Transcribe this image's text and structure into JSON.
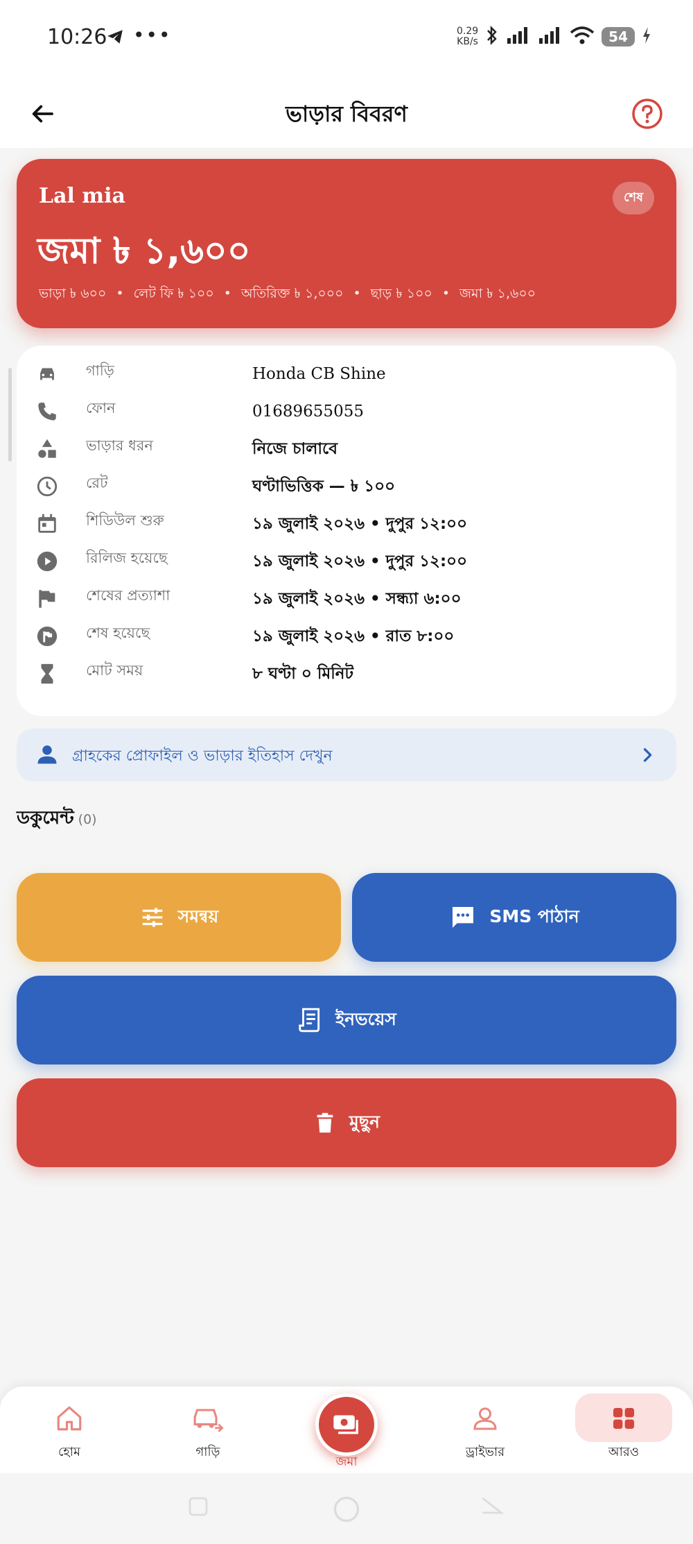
{
  "status_bar": {
    "time": "10:26",
    "speed_value": "0.29",
    "speed_unit": "KB/s",
    "battery": "54",
    "icons": [
      "telegram-icon",
      "bluetooth-icon",
      "signal-icon",
      "wifi-icon",
      "battery-icon"
    ]
  },
  "app_bar": {
    "title": "ভাড়ার বিবরণ"
  },
  "summary": {
    "customer_name": "Lal mia",
    "status_badge": "শেষ",
    "total": "জমা ৳ ১,৬০০",
    "breakdown": [
      "ভাড়া ৳ ৬০০",
      "লেট ফি ৳ ১০০",
      "অতিরিক্ত ৳ ১,০০০",
      "ছাড় ৳ ১০০",
      "জমা ৳ ১,৬০০"
    ]
  },
  "details": [
    {
      "icon": "car-icon",
      "label": "গাড়ি",
      "value": "Honda CB Shine"
    },
    {
      "icon": "phone-icon",
      "label": "ফোন",
      "value": "01689655055"
    },
    {
      "icon": "category-icon",
      "label": "ভাড়ার ধরন",
      "value": "নিজে চালাবে"
    },
    {
      "icon": "clock-icon",
      "label": "রেট",
      "value": "ঘণ্টাভিত্তিক — ৳ ১০০"
    },
    {
      "icon": "calendar-icon",
      "label": "শিডিউল শুরু",
      "value": "১৯ জুলাই ২০২৬ • দুপুর ১২:০০"
    },
    {
      "icon": "play-circle-icon",
      "label": "রিলিজ হয়েছে",
      "value": "১৯ জুলাই ২০২৬ • দুপুর ১২:০০"
    },
    {
      "icon": "flag-icon",
      "label": "শেষের প্রত্যাশা",
      "value": "১৯ জুলাই ২০২৬ • সন্ধ্যা ৬:০০"
    },
    {
      "icon": "flag-circle-icon",
      "label": "শেষ হয়েছে",
      "value": "১৯ জুলাই ২০২৬ • রাত ৮:০০"
    },
    {
      "icon": "hourglass-icon",
      "label": "মোট সময়",
      "value": "৮ ঘণ্টা ০ মিনিট"
    }
  ],
  "profile_link": {
    "label": "গ্রাহকের প্রোফাইল ও ভাড়ার ইতিহাস দেখুন"
  },
  "documents": {
    "title": "ডকুমেন্ট",
    "count": "(0)"
  },
  "actions": {
    "adjust": "সমন্বয়",
    "sms": "SMS পাঠান",
    "invoice": "ইনভয়েস",
    "delete": "মুছুন"
  },
  "bottom_nav": {
    "home": "হোম",
    "cars": "গাড়ি",
    "center": "জমা",
    "driver": "ড্রাইভার",
    "more": "আরও"
  },
  "colors": {
    "primary_red": "#d3473f",
    "primary_blue": "#3063bd",
    "amber": "#eba842",
    "link_bg": "#e6edf7"
  }
}
